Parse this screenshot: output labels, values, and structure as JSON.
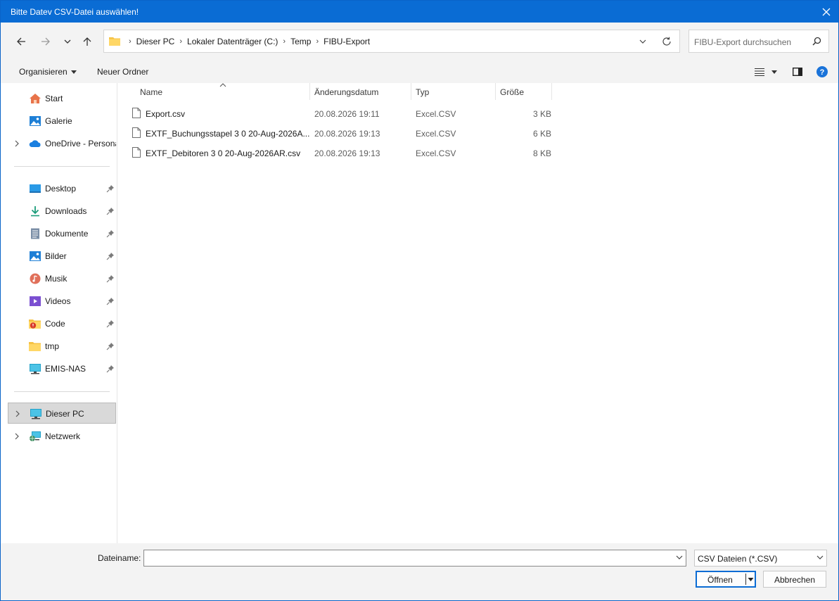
{
  "window": {
    "title": "Bitte Datev CSV-Datei auswählen!"
  },
  "address": {
    "crumbs": [
      "Dieser PC",
      "Lokaler Datenträger (C:)",
      "Temp",
      "FIBU-Export"
    ]
  },
  "search": {
    "placeholder": "FIBU-Export durchsuchen"
  },
  "toolbar": {
    "organize_label": "Organisieren",
    "new_folder_label": "Neuer Ordner"
  },
  "sidebar": {
    "items": [
      {
        "label": "Start",
        "icon": "home-icon"
      },
      {
        "label": "Galerie",
        "icon": "gallery-icon"
      },
      {
        "label": "OneDrive - Personal",
        "icon": "cloud-icon"
      },
      {
        "label": "Desktop",
        "icon": "desktop-icon"
      },
      {
        "label": "Downloads",
        "icon": "download-icon"
      },
      {
        "label": "Dokumente",
        "icon": "document-icon"
      },
      {
        "label": "Bilder",
        "icon": "pictures-icon"
      },
      {
        "label": "Musik",
        "icon": "music-icon"
      },
      {
        "label": "Videos",
        "icon": "videos-icon"
      },
      {
        "label": "Code",
        "icon": "folder-warning-icon"
      },
      {
        "label": "tmp",
        "icon": "folder-icon"
      },
      {
        "label": "EMIS-NAS",
        "icon": "network-drive-icon"
      },
      {
        "label": "Dieser PC",
        "icon": "computer-icon"
      },
      {
        "label": "Netzwerk",
        "icon": "network-icon"
      }
    ]
  },
  "columns": {
    "name": "Name",
    "date": "Änderungsdatum",
    "type": "Typ",
    "size": "Größe"
  },
  "files": [
    {
      "name": "Export.csv",
      "date": "20.08.2026 19:11",
      "type": "Excel.CSV",
      "size": "3 KB"
    },
    {
      "name": "EXTF_Buchungsstapel 3 0 20-Aug-2026A...",
      "date": "20.08.2026 19:13",
      "type": "Excel.CSV",
      "size": "6 KB"
    },
    {
      "name": "EXTF_Debitoren 3 0 20-Aug-2026AR.csv",
      "date": "20.08.2026 19:13",
      "type": "Excel.CSV",
      "size": "8 KB"
    }
  ],
  "footer": {
    "filename_label": "Dateiname:",
    "filename_value": "",
    "filter_value": "CSV Dateien (*.CSV)",
    "open_label": "Öffnen",
    "cancel_label": "Abbrechen"
  },
  "colors": {
    "titlebar": "#0a6cd4",
    "accent": "#0a6cd4",
    "help": "#1a73d9"
  }
}
